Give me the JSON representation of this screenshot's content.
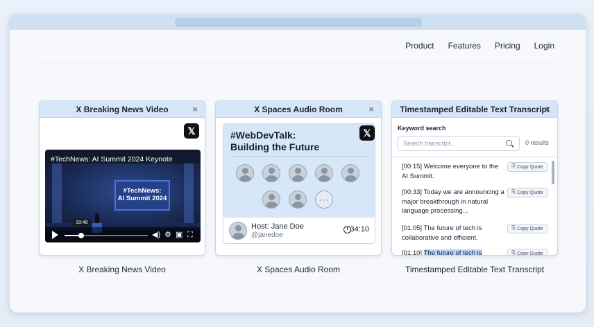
{
  "nav": {
    "items": [
      "Product",
      "Features",
      "Pricing",
      "Login"
    ]
  },
  "cards": [
    {
      "header": "X Breaking News Video",
      "caption": "X Breaking News Video",
      "video_title": "#TechNews: AI Summit 2024 Keynote",
      "screen_line1": "#TechNews:",
      "screen_line2": "AI Summit 2024",
      "time_tooltip": "18:48",
      "progress": 0.2
    },
    {
      "header": "X Spaces Audio Room",
      "caption": "X Spaces Audio Room",
      "room_title_line1": "#WebDevTalk:",
      "room_title_line2": "Building the Future",
      "more_label": "···",
      "host_name": "Host: Jane Doe",
      "host_handle": "@janedoe",
      "duration": "34:10"
    },
    {
      "header": "Timestamped Editable Text Transcript",
      "caption": "Timestamped Editable Text Transcript",
      "keyword_label": "Keyword search",
      "search_placeholder": "Search transcript...",
      "results": "0 results",
      "copy_label": "Copy Quote",
      "entries": [
        {
          "time": "[00:15]",
          "text": "Welcome everyone to the AI Summit."
        },
        {
          "time": "[00:33]",
          "text": "Today we are announcing a major breakthrough in natural language processing..."
        },
        {
          "time": "[01:05]",
          "text": "The future of tech is collaborative and efficient."
        },
        {
          "time": "[01:10]",
          "text": "The future of tech is"
        }
      ]
    }
  ],
  "close_symbol": "×",
  "x_logo": "𝕏"
}
